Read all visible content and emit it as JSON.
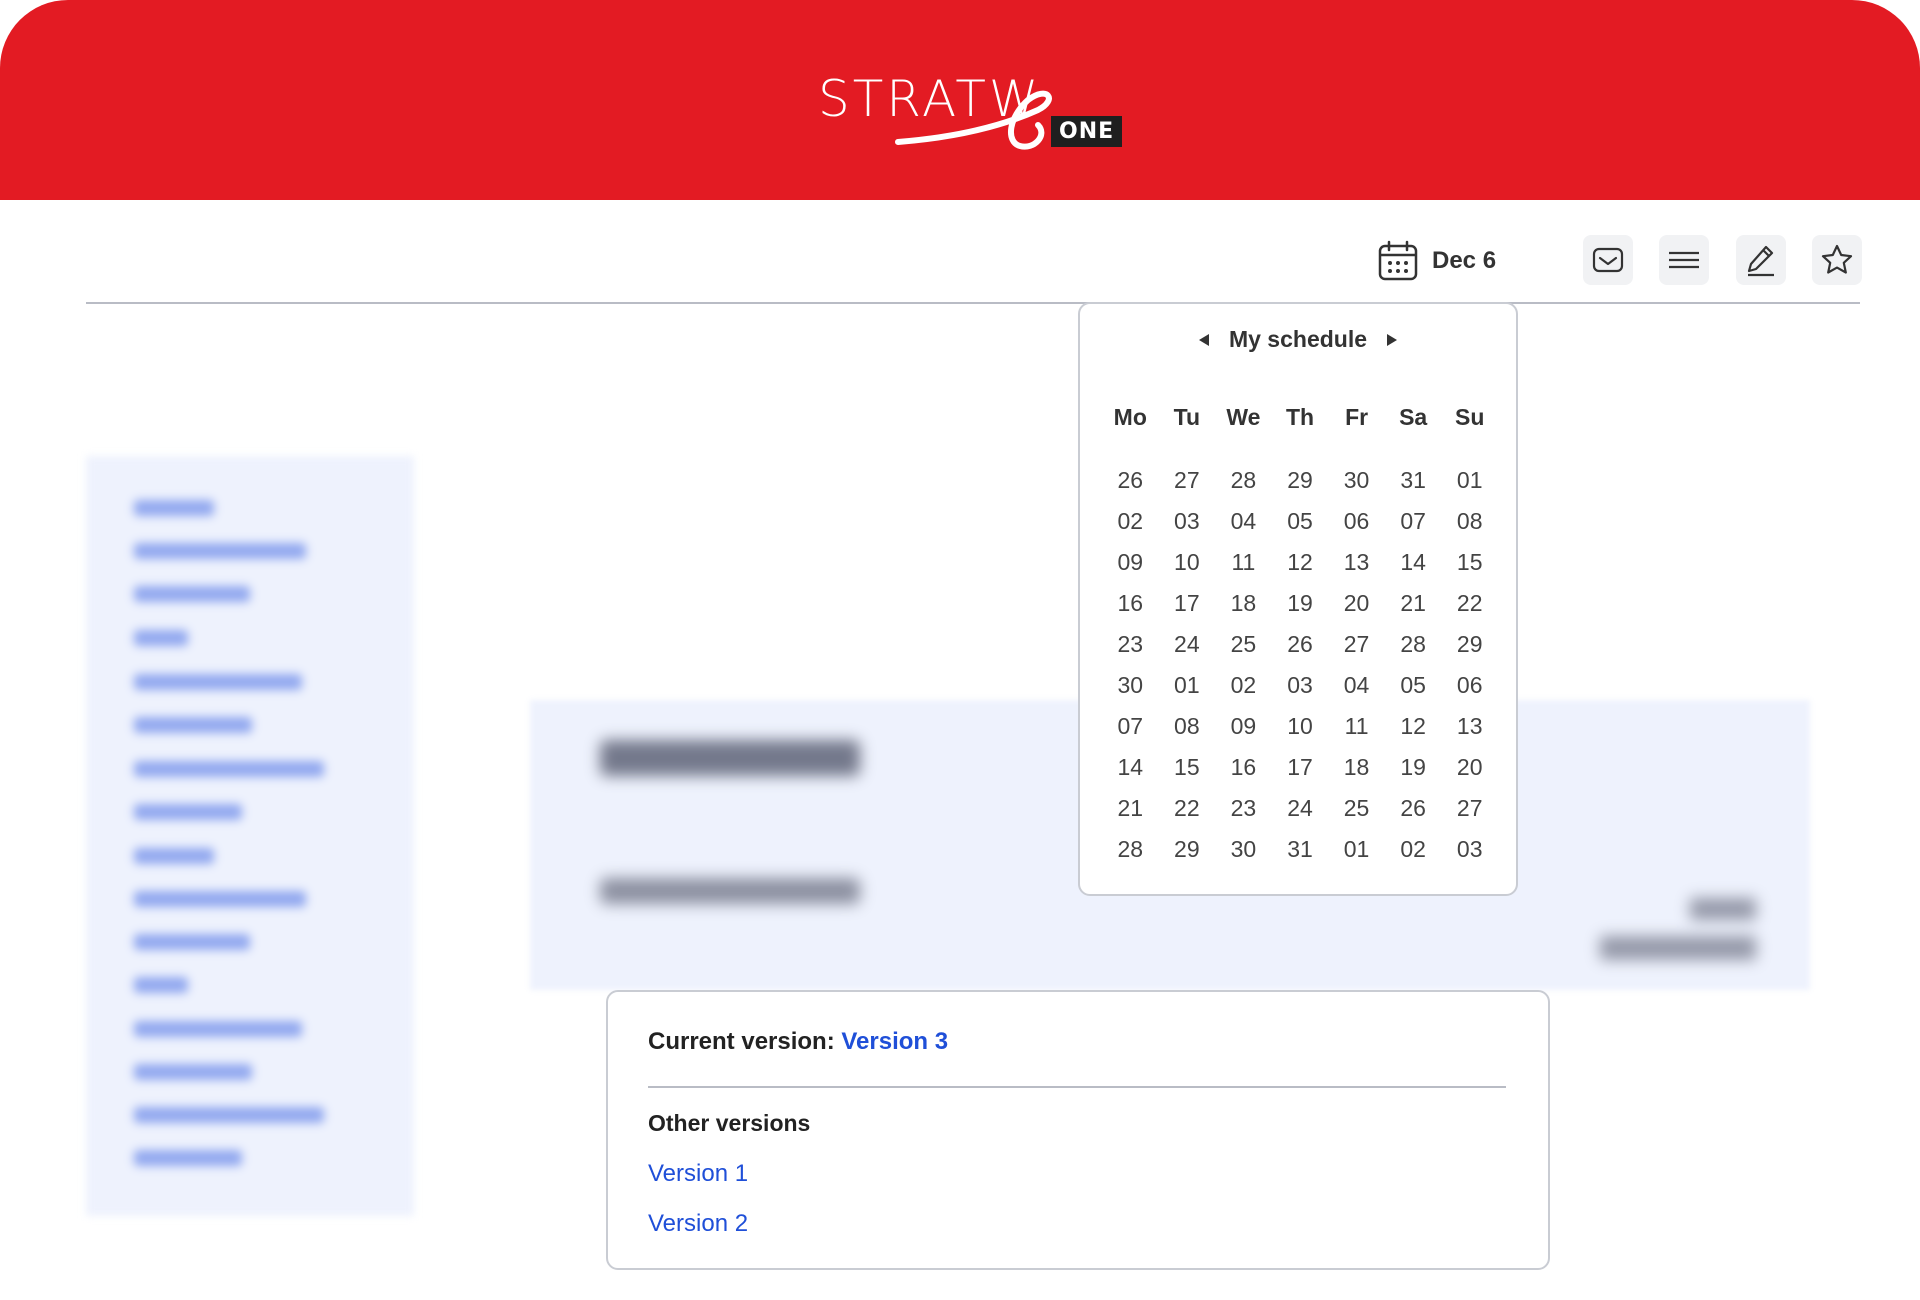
{
  "header": {
    "logo_text": "STRATW",
    "logo_badge": "ONE",
    "brand_color": "#e31b23"
  },
  "toolbar": {
    "date_label": "Dec 6",
    "date_icon": "calendar-icon",
    "buttons": [
      "inbox-icon",
      "menu-icon",
      "edit-icon",
      "star-icon"
    ]
  },
  "schedule": {
    "title": "My schedule",
    "weekdays": [
      "Mo",
      "Tu",
      "We",
      "Th",
      "Fr",
      "Sa",
      "Su"
    ],
    "weeks": [
      [
        "26",
        "27",
        "28",
        "29",
        "30",
        "31",
        "01"
      ],
      [
        "02",
        "03",
        "04",
        "05",
        "06",
        "07",
        "08"
      ],
      [
        "09",
        "10",
        "11",
        "12",
        "13",
        "14",
        "15"
      ],
      [
        "16",
        "17",
        "18",
        "19",
        "20",
        "21",
        "22"
      ],
      [
        "23",
        "24",
        "25",
        "26",
        "27",
        "28",
        "29"
      ],
      [
        "30",
        "01",
        "02",
        "03",
        "04",
        "05",
        "06"
      ],
      [
        "07",
        "08",
        "09",
        "10",
        "11",
        "12",
        "13"
      ],
      [
        "14",
        "15",
        "16",
        "17",
        "18",
        "19",
        "20"
      ],
      [
        "21",
        "22",
        "23",
        "24",
        "25",
        "26",
        "27"
      ],
      [
        "28",
        "29",
        "30",
        "31",
        "01",
        "02",
        "03"
      ]
    ]
  },
  "versions": {
    "current_label": "Current version:",
    "current_value": "Version 3",
    "other_title": "Other versions",
    "others": [
      "Version 1",
      "Version 2"
    ],
    "link_color": "#1f4fd8"
  }
}
